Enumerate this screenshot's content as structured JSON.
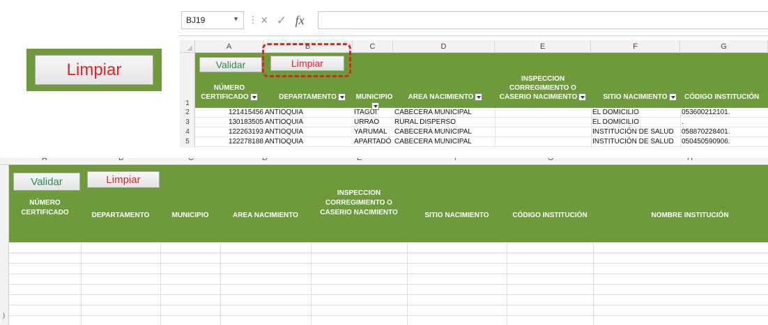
{
  "callout": {
    "button_label": "Limpiar"
  },
  "top": {
    "namebox": "BJ19",
    "formula_icons": {
      "cancel": "×",
      "enter": "✓",
      "fx": "fx"
    },
    "columns": [
      "A",
      "B",
      "C",
      "D",
      "E",
      "F",
      "G"
    ],
    "rows": [
      "1",
      "2",
      "3",
      "4",
      "5"
    ],
    "buttons": {
      "validar": "Validar",
      "limpiar": "Limpiar"
    },
    "headers": {
      "numero_l1": "NÚMERO",
      "numero_l2": "CERTIFICADO",
      "departamento": "DEPARTAMENTO",
      "municipio": "MUNICIPIO",
      "area": "AREA NACIMIENTO",
      "insp_l1": "INSPECCION",
      "insp_l2": "CORREGIMIENTO O",
      "insp_l3": "CASERIO NACIMIENTO",
      "sitio": "SITIO NACIMIENTO",
      "codigo": "CÓDIGO INSTITUCIÓN"
    },
    "data": [
      {
        "numero": "121415456",
        "departamento": "ANTIOQUIA",
        "municipio": "ITAGUI",
        "area": "CABECERA MUNICIPAL",
        "inspeccion": "",
        "sitio": "EL DOMICILIO",
        "codigo": "053600212101."
      },
      {
        "numero": "130183505",
        "departamento": "ANTIOQUIA",
        "municipio": "URRAO",
        "area": "RURAL DISPERSO",
        "inspeccion": "",
        "sitio": "EL DOMICILIO",
        "codigo": "."
      },
      {
        "numero": "122263193",
        "departamento": "ANTIOQUIA",
        "municipio": "YARUMAL",
        "area": "CABECERA MUNICIPAL",
        "inspeccion": "",
        "sitio": "INSTITUCIÓN DE SALUD",
        "codigo": "058870228401."
      },
      {
        "numero": "122278188",
        "departamento": "ANTIOQUIA",
        "municipio": "APARTADÓ",
        "area": "CABECERA MUNICIPAL",
        "inspeccion": "",
        "sitio": "INSTITUCIÓN DE SALUD",
        "codigo": "050450590906."
      }
    ]
  },
  "bottom": {
    "columns": [
      "A",
      "B",
      "C",
      "D",
      "E",
      "F",
      "G",
      "H"
    ],
    "buttons": {
      "validar": "Validar",
      "limpiar": "Limpiar"
    },
    "headers": {
      "numero_l1": "NÚMERO",
      "numero_l2": "CERTIFICADO",
      "departamento": "DEPARTAMENTO",
      "municipio": "MUNICIPIO",
      "area": "AREA NACIMIENTO",
      "insp_l1": "INSPECCION",
      "insp_l2": "CORREGIMIENTO O",
      "insp_l3": "CASERIO NACIMIENTO",
      "sitio": "SITIO NACIMIENTO",
      "codigo": "CÓDIGO INSTITUCIÓN",
      "nombre": "NOMBRE INSTITUCIÓN"
    },
    "row_fragment": ")"
  },
  "colors": {
    "header_green": "#6e9a3c",
    "validar_text": "#2e8a52",
    "limpiar_text": "#e32222",
    "highlight": "#d9261c"
  }
}
